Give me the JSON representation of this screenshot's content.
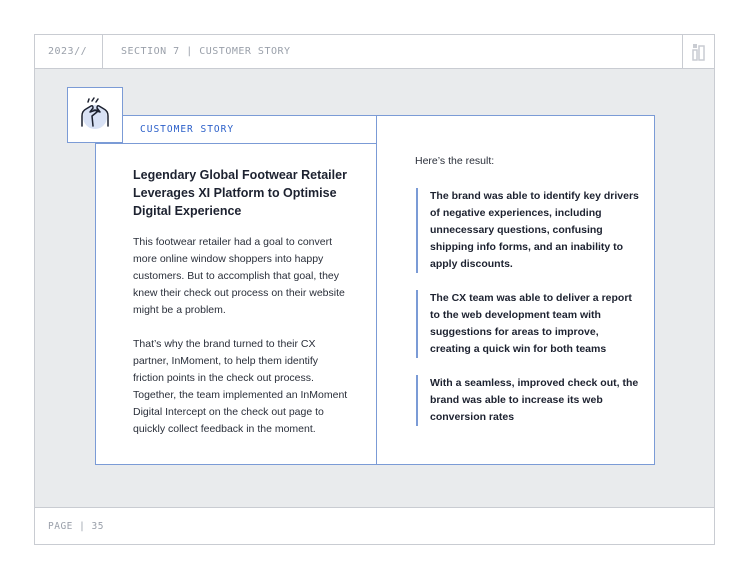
{
  "header": {
    "year": "2023//",
    "section": "SECTION 7 | CUSTOMER STORY"
  },
  "footer": {
    "page": "PAGE | 35"
  },
  "card": {
    "tag": "CUSTOMER STORY",
    "icon": "high-five-icon",
    "title": "Legendary Global Footwear Retailer Leverages XI Platform to Optimise Digital Experience",
    "paragraphs": [
      "This footwear retailer had a goal to convert more online window shoppers into happy customers. But to accomplish that goal, they knew their check out process on their website might be a problem.",
      "That’s why the brand turned to their CX partner, InMoment, to help them identify friction points in the check out process. Together, the team implemented an InMoment Digital Intercept on the check out page to quickly collect feedback in the moment."
    ],
    "result_intro": "Here’s the result:",
    "results": [
      "The brand was able to identify key drivers of negative experiences, including unnecessary questions, confusing shipping info forms, and an inability to apply discounts.",
      "The CX team was able to deliver a report to the web development team with suggestions for areas to improve, creating a quick win for both teams",
      "With a seamless, improved check out, the brand was able to increase its web conversion rates"
    ]
  },
  "colors": {
    "accent": "#2b5fc9",
    "border": "#7b9bd6",
    "background": "#e9ebed"
  }
}
